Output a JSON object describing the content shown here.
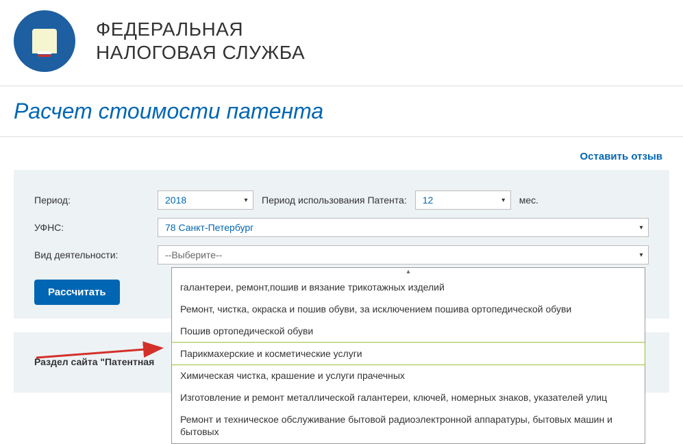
{
  "header": {
    "org_line1": "ФЕДЕРАЛЬНАЯ",
    "org_line2": "НАЛОГОВАЯ СЛУЖБА"
  },
  "page_title": "Расчет стоимости патента",
  "feedback_link": "Оставить отзыв",
  "form": {
    "period_label": "Период:",
    "period_value": "2018",
    "usage_period_label": "Период использования Патента:",
    "usage_period_value": "12",
    "months_suffix": "мес.",
    "ufns_label": "УФНС:",
    "ufns_value": "78 Санкт-Петербург",
    "activity_label": "Вид деятельности:",
    "activity_placeholder": "--Выберите--",
    "calculate_button": "Рассчитать"
  },
  "dropdown": {
    "items": [
      "галантереи, ремонт,пошив и вязание трикотажных изделий",
      "Ремонт, чистка, окраска и пошив обуви, за исключением пошива ортопедической обуви",
      "Пошив ортопедической обуви",
      "Парикмахерские и косметические услуги",
      "Химическая чистка, крашение и услуги прачечных",
      "Изготовление и ремонт металлической галантереи, ключей, номерных знаков, указателей улиц",
      "Ремонт и техническое обслуживание бытовой радиоэлектронной аппаратуры, бытовых машин и бытовых"
    ],
    "highlighted_index": 3
  },
  "section_footer": "Раздел сайта \"Патентная"
}
